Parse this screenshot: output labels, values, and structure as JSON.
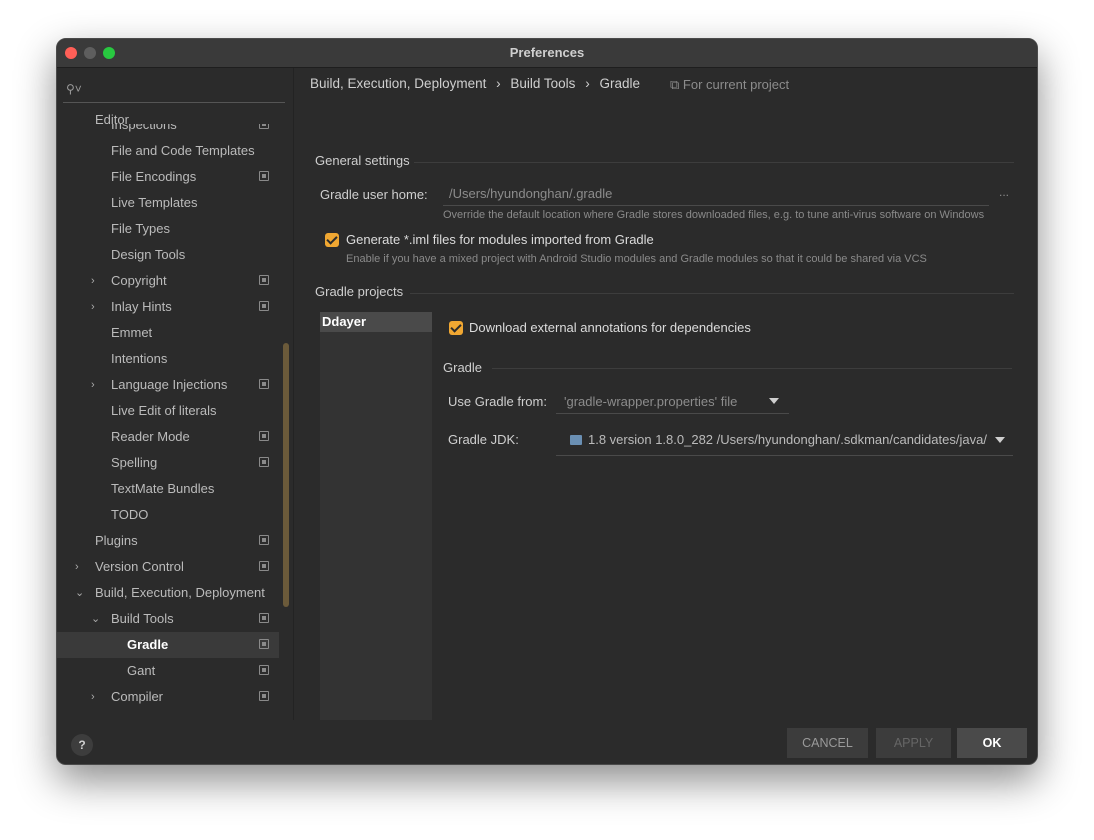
{
  "window": {
    "title": "Preferences"
  },
  "sidebar": {
    "search_placeholder": "",
    "editor_label": "Editor",
    "items": [
      {
        "label": "Inspections",
        "indent": 2,
        "arrow": "",
        "copy": true,
        "selected": false
      },
      {
        "label": "File and Code Templates",
        "indent": 2,
        "arrow": "",
        "copy": false,
        "selected": false
      },
      {
        "label": "File Encodings",
        "indent": 2,
        "arrow": "",
        "copy": true,
        "selected": false
      },
      {
        "label": "Live Templates",
        "indent": 2,
        "arrow": "",
        "copy": false,
        "selected": false
      },
      {
        "label": "File Types",
        "indent": 2,
        "arrow": "",
        "copy": false,
        "selected": false
      },
      {
        "label": "Design Tools",
        "indent": 2,
        "arrow": "",
        "copy": false,
        "selected": false
      },
      {
        "label": "Copyright",
        "indent": 2,
        "arrow": "›",
        "copy": true,
        "selected": false
      },
      {
        "label": "Inlay Hints",
        "indent": 2,
        "arrow": "›",
        "copy": true,
        "selected": false
      },
      {
        "label": "Emmet",
        "indent": 2,
        "arrow": "",
        "copy": false,
        "selected": false
      },
      {
        "label": "Intentions",
        "indent": 2,
        "arrow": "",
        "copy": false,
        "selected": false
      },
      {
        "label": "Language Injections",
        "indent": 2,
        "arrow": "›",
        "copy": true,
        "selected": false
      },
      {
        "label": "Live Edit of literals",
        "indent": 2,
        "arrow": "",
        "copy": false,
        "selected": false
      },
      {
        "label": "Reader Mode",
        "indent": 2,
        "arrow": "",
        "copy": true,
        "selected": false
      },
      {
        "label": "Spelling",
        "indent": 2,
        "arrow": "",
        "copy": true,
        "selected": false
      },
      {
        "label": "TextMate Bundles",
        "indent": 2,
        "arrow": "",
        "copy": false,
        "selected": false
      },
      {
        "label": "TODO",
        "indent": 2,
        "arrow": "",
        "copy": false,
        "selected": false
      },
      {
        "label": "Plugins",
        "indent": 1,
        "arrow": "",
        "copy": true,
        "selected": false
      },
      {
        "label": "Version Control",
        "indent": 1,
        "arrow": "›",
        "copy": true,
        "selected": false
      },
      {
        "label": "Build, Execution, Deployment",
        "indent": 1,
        "arrow": "⌄",
        "copy": false,
        "selected": false
      },
      {
        "label": "Build Tools",
        "indent": 2,
        "arrow": "⌄",
        "copy": true,
        "selected": false
      },
      {
        "label": "Gradle",
        "indent": 3,
        "arrow": "",
        "copy": true,
        "selected": true
      },
      {
        "label": "Gant",
        "indent": 3,
        "arrow": "",
        "copy": true,
        "selected": false
      },
      {
        "label": "Compiler",
        "indent": 2,
        "arrow": "›",
        "copy": true,
        "selected": false
      }
    ]
  },
  "breadcrumb": {
    "parts": [
      "Build, Execution, Deployment",
      "Build Tools",
      "Gradle"
    ],
    "separator": "›",
    "for_current_project": "For current project"
  },
  "general": {
    "title": "General settings",
    "user_home_label": "Gradle user home:",
    "user_home_value": "/Users/hyundonghan/.gradle",
    "user_home_browse": "...",
    "user_home_hint": "Override the default location where Gradle stores downloaded files, e.g. to tune anti-virus software on Windows",
    "generate_iml_label": "Generate *.iml files for modules imported from Gradle",
    "generate_iml_hint": "Enable if you have a mixed project with Android Studio modules and Gradle modules so that it could be shared via VCS"
  },
  "projects": {
    "title": "Gradle projects",
    "list": [
      "Ddayer"
    ],
    "download_annotations_label": "Download external annotations for dependencies",
    "gradle_section_title": "Gradle",
    "use_gradle_from_label": "Use Gradle from:",
    "use_gradle_from_value": "'gradle-wrapper.properties' file",
    "gradle_jdk_label": "Gradle JDK:",
    "gradle_jdk_value": "1.8 version 1.8.0_282 /Users/hyundonghan/.sdkman/candidates/java/"
  },
  "footer": {
    "help": "?",
    "cancel": "CANCEL",
    "apply": "APPLY",
    "ok": "OK"
  },
  "colors": {
    "accent_checkbox": "#f0a732",
    "background": "#2b2b2b"
  }
}
